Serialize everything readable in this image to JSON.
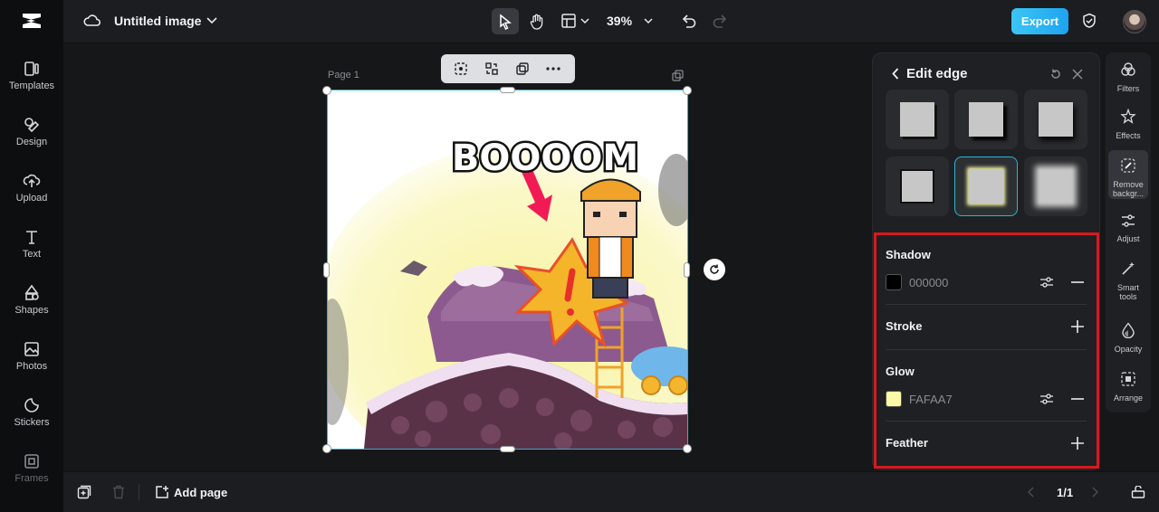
{
  "app": {
    "document_title": "Untitled image"
  },
  "left_rail": {
    "items": [
      {
        "label": "Templates",
        "icon": "templates-icon"
      },
      {
        "label": "Design",
        "icon": "design-icon"
      },
      {
        "label": "Upload",
        "icon": "upload-icon"
      },
      {
        "label": "Text",
        "icon": "text-icon"
      },
      {
        "label": "Shapes",
        "icon": "shapes-icon"
      },
      {
        "label": "Photos",
        "icon": "photos-icon"
      },
      {
        "label": "Stickers",
        "icon": "stickers-icon"
      },
      {
        "label": "Frames",
        "icon": "frames-icon"
      }
    ]
  },
  "toolbar": {
    "zoom": "39%",
    "export_label": "Export"
  },
  "canvas": {
    "page_label": "Page 1",
    "artwork_text": "BOOOOM"
  },
  "bottom": {
    "add_page_label": "Add page",
    "page_indicator": "1/1"
  },
  "edit_edge": {
    "title": "Edit edge",
    "selected_preset_index": 4,
    "shadow": {
      "label": "Shadow",
      "color": "#000000",
      "value": "000000"
    },
    "stroke": {
      "label": "Stroke"
    },
    "glow": {
      "label": "Glow",
      "color": "#FAFAA7",
      "value": "FAFAA7"
    },
    "feather": {
      "label": "Feather"
    }
  },
  "right_rail": {
    "items": [
      {
        "label": "Filters",
        "icon": "filters-icon"
      },
      {
        "label": "Effects",
        "icon": "effects-icon"
      },
      {
        "label": "Remove backgr...",
        "icon": "remove-background-icon",
        "active": true
      },
      {
        "label": "Adjust",
        "icon": "adjust-icon"
      },
      {
        "label": "Smart tools",
        "icon": "smart-tools-icon"
      },
      {
        "label": "Opacity",
        "icon": "opacity-icon"
      },
      {
        "label": "Arrange",
        "icon": "arrange-icon"
      }
    ]
  },
  "colors": {
    "accent": "#2BB4D4",
    "export_gradient_start": "#3BC5F5",
    "highlight_border": "#D71920"
  }
}
